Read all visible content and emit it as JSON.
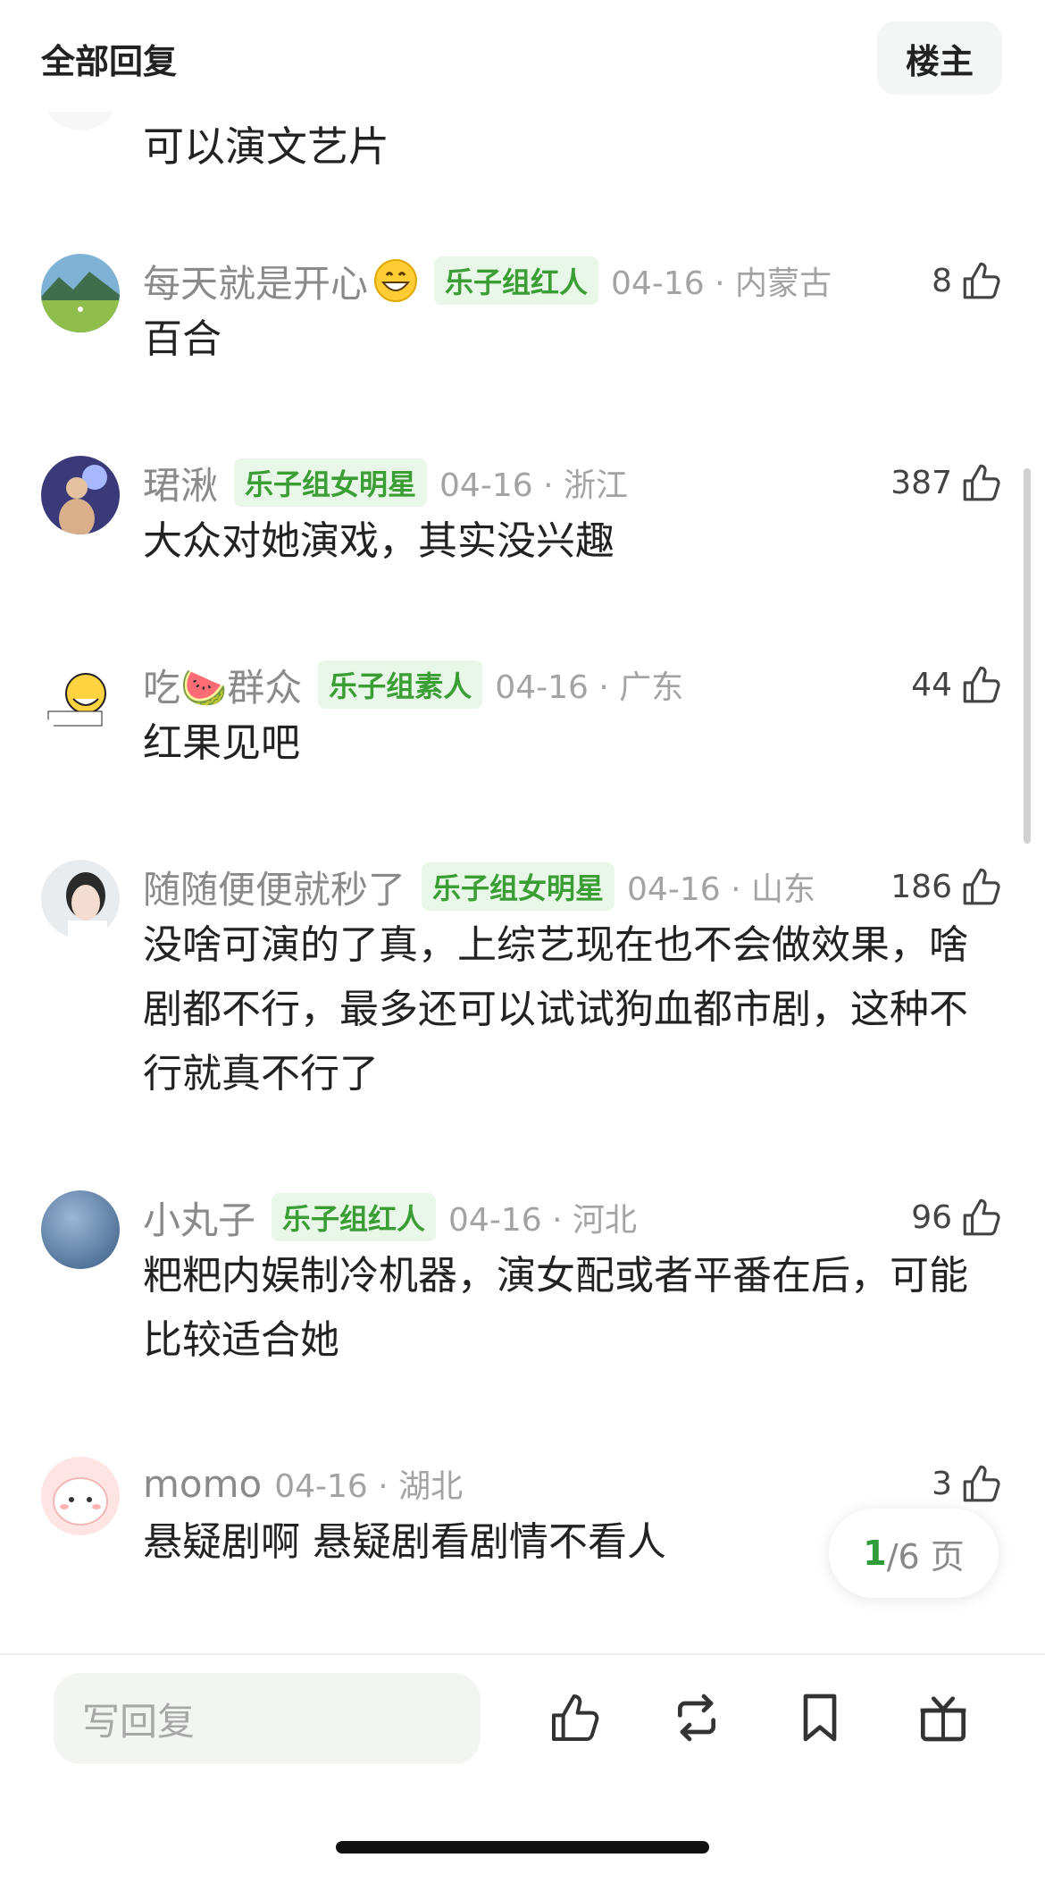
{
  "header": {
    "title": "全部回复",
    "op_button": "楼主"
  },
  "partial_comment": {
    "text": "可以演文艺片"
  },
  "comments": [
    {
      "username": "每天就是开心",
      "has_emoji": true,
      "badge": "乐子组红人",
      "time": "04-16 · 内蒙古",
      "likes": "8",
      "text": "百合"
    },
    {
      "username": "珺湫",
      "badge": "乐子组女明星",
      "time": "04-16 · 浙江",
      "likes": "387",
      "text": "大众对她演戏，其实没兴趣"
    },
    {
      "username": "吃🍉群众",
      "badge": "乐子组素人",
      "time": "04-16 · 广东",
      "likes": "44",
      "text": "红果见吧"
    },
    {
      "username": "随随便便就秒了",
      "badge": "乐子组女明星",
      "time": "04-16 · 山东",
      "likes": "186",
      "text": "没啥可演的了真，上综艺现在也不会做效果，啥剧都不行，最多还可以试试狗血都市剧，这种不行就真不行了"
    },
    {
      "username": "小丸子",
      "badge": "乐子组红人",
      "time": "04-16 · 河北",
      "likes": "96",
      "text": "粑粑内娱制冷机器，演女配或者平番在后，可能比较适合她"
    },
    {
      "username": "momo",
      "badge": "",
      "time": "04-16 · 湖北",
      "likes": "3",
      "text": "悬疑剧啊 悬疑剧看剧情不看人"
    }
  ],
  "pager": {
    "current": "1",
    "rest": "/6 页"
  },
  "bottom_bar": {
    "reply_placeholder": "写回复"
  },
  "icons": [
    "thumb-up-icon",
    "repost-icon",
    "bookmark-icon",
    "gift-icon"
  ],
  "colors": {
    "badge_bg": "#e9f7e8",
    "badge_text": "#3a9e35",
    "pager_accent": "#2e9d3a"
  }
}
